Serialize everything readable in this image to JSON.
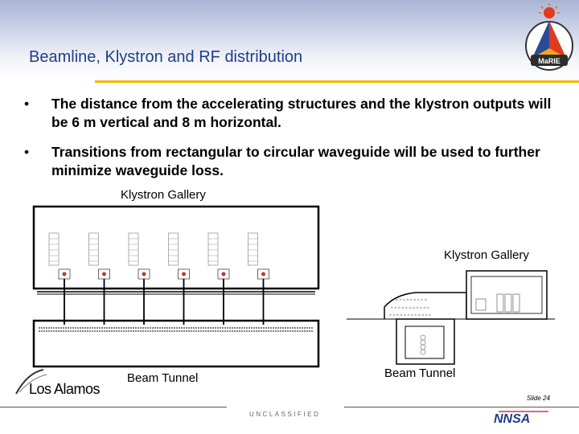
{
  "slide": {
    "title": "Beamline, Klystron and RF distribution",
    "bullets": [
      {
        "marker": "•",
        "text": "The distance from the accelerating structures and the klystron outputs will be 6 m vertical and 8 m horizontal."
      },
      {
        "marker": "•",
        "text": "Transitions from rectangular to circular waveguide will be used to further minimize waveguide loss."
      }
    ],
    "diagram": {
      "plan_top_label": "Klystron Gallery",
      "plan_bottom_label": "Beam Tunnel",
      "section_top_label": "Klystron Gallery",
      "section_bottom_label": "Beam Tunnel",
      "klystron_count": 6
    },
    "footer": {
      "org_logo_text": "Los Alamos",
      "slide_number": "Slide 24",
      "classification": "UNCLASSIFIED",
      "partner_logo_text": "NNSA"
    },
    "badge_text": "MaRIE"
  },
  "colors": {
    "title": "#1f3d8c",
    "accent_rule": "#f1b400",
    "header_band": "#a9b4d4"
  }
}
